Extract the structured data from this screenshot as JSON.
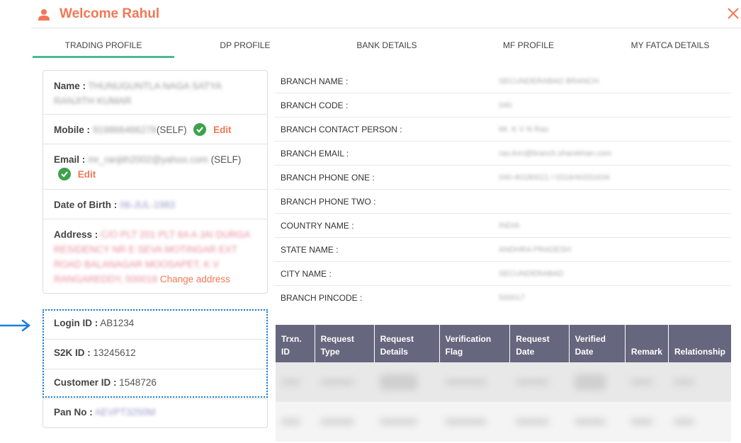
{
  "header": {
    "title": "Welcome Rahul",
    "user_icon": "user-icon",
    "close_icon": "close-icon"
  },
  "colors": {
    "accent": "#f47755",
    "tab_indicator": "#4db88d",
    "table_header": "#66677e",
    "verified_check": "#3ca24a",
    "highlight_border": "#1a7fe0"
  },
  "tabs": [
    {
      "label": "TRADING PROFILE",
      "active": true
    },
    {
      "label": "DP PROFILE",
      "active": false
    },
    {
      "label": "BANK DETAILS",
      "active": false
    },
    {
      "label": "MF PROFILE",
      "active": false
    },
    {
      "label": "MY FATCA DETAILS",
      "active": false
    }
  ],
  "profile": {
    "name": {
      "label": "Name :",
      "value": "THUNUGUNTLA NAGA SATYA RANJITH KUMAR"
    },
    "mobile": {
      "label": "Mobile :",
      "value": "919866466278",
      "suffix": "(SELF)",
      "edit_label": "Edit"
    },
    "email": {
      "label": "Email :",
      "value": "mr_ranjith2002@yahoo.com",
      "suffix": " (SELF)",
      "edit_label": "Edit"
    },
    "dob": {
      "label": "Date of Birth :",
      "value": "06-JUL-1983"
    },
    "address": {
      "label": "Address :",
      "value": "C/O PLT 201 PLT 6A A JAI DURGA RESIDENCY NR E SEVA MOTINGAR EXT ROAD BALANAGAR MOOSAPET, K V RANGAREDDY, 500018",
      "change_label": "Change address"
    },
    "login_id": {
      "label": "Login ID :",
      "value": "AB1234"
    },
    "s2k_id": {
      "label": "S2K ID :",
      "value": "13245612"
    },
    "customer_id": {
      "label": "Customer ID :",
      "value": "1548726"
    },
    "pan_no": {
      "label": "Pan No :",
      "value": "AEVPT3250M"
    }
  },
  "branch": [
    {
      "label": "BRANCH NAME :",
      "value": "SECUNDERABAD BRANCH"
    },
    {
      "label": "BRANCH CODE :",
      "value": "040"
    },
    {
      "label": "BRANCH CONTACT PERSON :",
      "value": "Mr. K V N Rao"
    },
    {
      "label": "BRANCH EMAIL :",
      "value": "rao.kvn@branch.sharekhan.com"
    },
    {
      "label": "BRANCH PHONE ONE :",
      "value": "040-40180021 / 0316/40331634"
    },
    {
      "label": "BRANCH PHONE TWO :",
      "value": ""
    },
    {
      "label": "COUNTRY NAME :",
      "value": "INDIA"
    },
    {
      "label": "STATE NAME :",
      "value": "ANDHRA PRADESH"
    },
    {
      "label": "CITY NAME :",
      "value": "SECUNDERABAD"
    },
    {
      "label": "BRANCH PINCODE :",
      "value": "500017"
    }
  ],
  "requests_table": {
    "columns": [
      "Trxn. ID",
      "Request Type",
      "Request Details",
      "Verification Flag",
      "Request Date",
      "Verified Date",
      "Remark",
      "Relationship"
    ]
  }
}
